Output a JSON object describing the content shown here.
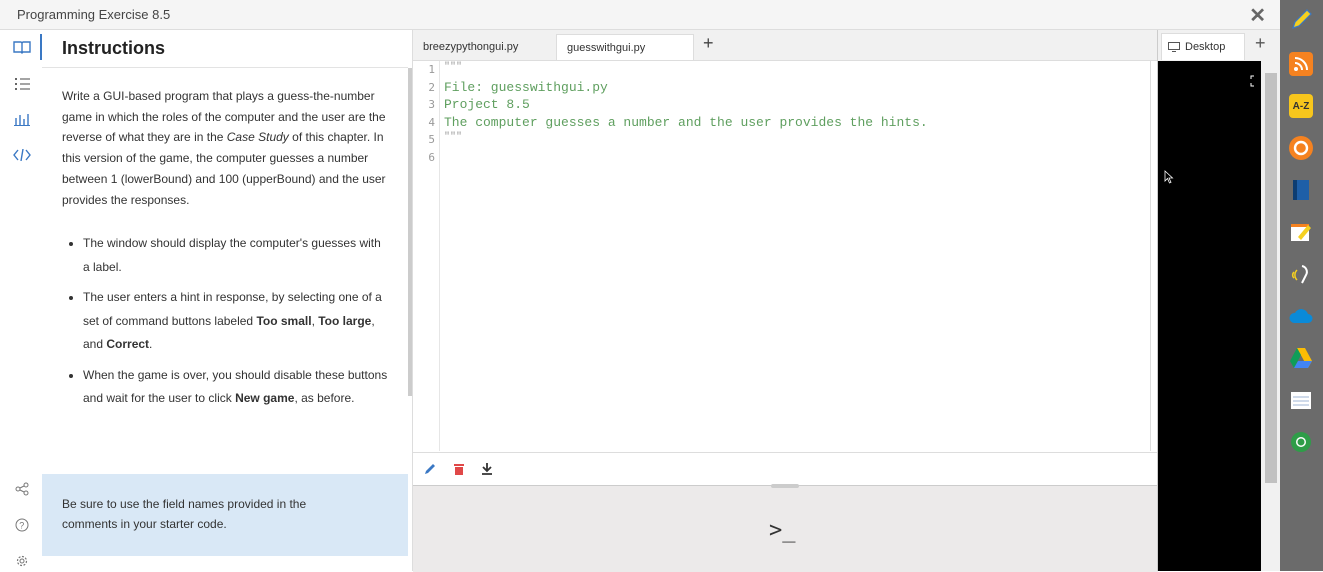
{
  "window": {
    "title": "Programming Exercise 8.5",
    "close_label": "✕"
  },
  "instructions": {
    "heading": "Instructions",
    "p1_a": "Write a GUI-based program that plays a guess-the-number game in which the roles of the computer and the user are the reverse of what they are in the ",
    "p1_em": "Case Study",
    "p1_b": " of this chapter. In this version of the game, the computer guesses a number between 1 (lowerBound) and 100 (upperBound) and the user provides the responses.",
    "b1": "The window should display the computer's guesses with a label.",
    "b2_a": "The user enters a hint in response, by selecting one of a set of command buttons labeled ",
    "b2_s1": "Too small",
    "b2_sep1": ", ",
    "b2_s2": "Too large",
    "b2_sep2": ", and ",
    "b2_s3": "Correct",
    "b2_end": ".",
    "b3_a": "When the game is over, you should disable these buttons and wait for the user to click ",
    "b3_s": "New game",
    "b3_end": ", as before.",
    "note": "Be sure to use the field names provided in the comments in your starter code."
  },
  "editor": {
    "tabs": [
      "breezypythongui.py",
      "guesswithgui.py"
    ],
    "add_tab": "+",
    "line_numbers": [
      "1",
      "2",
      "3",
      "4",
      "5",
      "6"
    ],
    "lines": [
      "\"\"\"",
      "File: guesswithgui.py",
      "Project 8.5",
      "The computer guesses a number and the user provides the hints.",
      "\"\"\"",
      ""
    ]
  },
  "terminal": {
    "prompt": ">_"
  },
  "desktop": {
    "tab_label": "Desktop",
    "add": "+"
  },
  "colors": {
    "note_bg": "#d9e8f6",
    "code_green": "#5f9f5f",
    "delete_red": "#e04848"
  },
  "dock_apps": [
    "rss-icon",
    "a-z-icon",
    "b-icon",
    "book-icon",
    "note-icon",
    "speech-icon",
    "cloud-icon",
    "drive-icon",
    "notepad-icon",
    "green-circle-icon"
  ],
  "dock_az": "A-Z"
}
